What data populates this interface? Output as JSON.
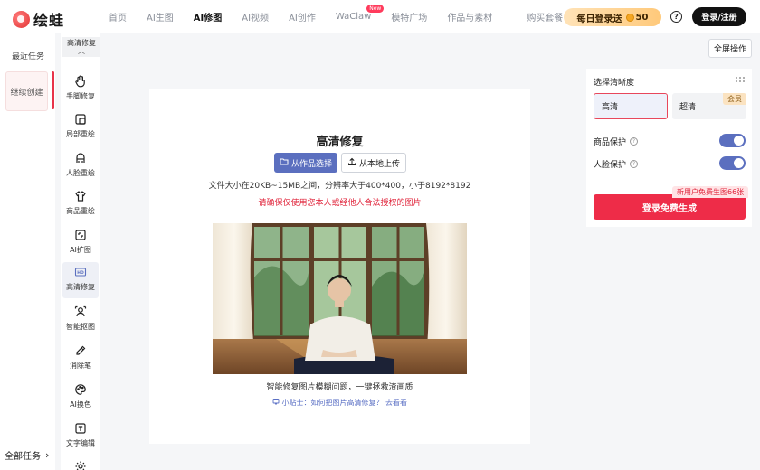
{
  "header": {
    "logo_text": "绘蛙",
    "nav": [
      "首页",
      "AI生图",
      "AI修图",
      "AI视频",
      "AI创作",
      "WaClaw",
      "模特广场",
      "作品与素材",
      "购买套餐"
    ],
    "nav_active": "AI修图",
    "new_badge": "New",
    "daily_label": "每日登录送",
    "daily_points": "50",
    "help_symbol": "?",
    "login_label": "登录/注册"
  },
  "left": {
    "recent_label": "最近任务",
    "recent_card": "继续创建",
    "all_tasks": "全部任务"
  },
  "tools": {
    "header_label": "高清修复",
    "items": [
      "手脚修复",
      "局部重绘",
      "人脸重绘",
      "商品重绘",
      "AI扩图",
      "高清修复",
      "智能抠图",
      "消除笔",
      "AI换色",
      "文字编辑"
    ],
    "icons": [
      "hand-icon",
      "crop-icon",
      "face-icon",
      "shirt-icon",
      "expand-icon",
      "hd-icon",
      "portrait-icon",
      "eraser-icon",
      "palette-icon",
      "text-icon",
      "settings-icon"
    ],
    "active_index": 5
  },
  "canvas": {
    "fullscreen": "全屏操作",
    "title": "高清修复",
    "from_works": "从作品选择",
    "upload_local": "从本地上传",
    "file_info": "文件大小在20KB~15MB之间，分辨率大于400*400，小于8192*8192",
    "warning": "请确保仅使用您本人或经他人合法授权的图片",
    "caption": "智能修复图片模糊问题，一键拯救渣画质",
    "tip": "小贴士：如何把图片高清修复？ 去看看"
  },
  "settings": {
    "title": "选择清晰度",
    "option_hd": "高清",
    "option_uhd": "超清",
    "member_tag": "会员",
    "product_protect": "商品保护",
    "face_protect": "人脸保护",
    "product_protect_on": true,
    "face_protect_on": true,
    "promo": "新用户免费生图66张",
    "generate": "登录免费生成"
  },
  "colors": {
    "accent_red": "#ee2c48",
    "primary_blue": "#5b6fbf",
    "daily_gold": "#ffc97a"
  }
}
